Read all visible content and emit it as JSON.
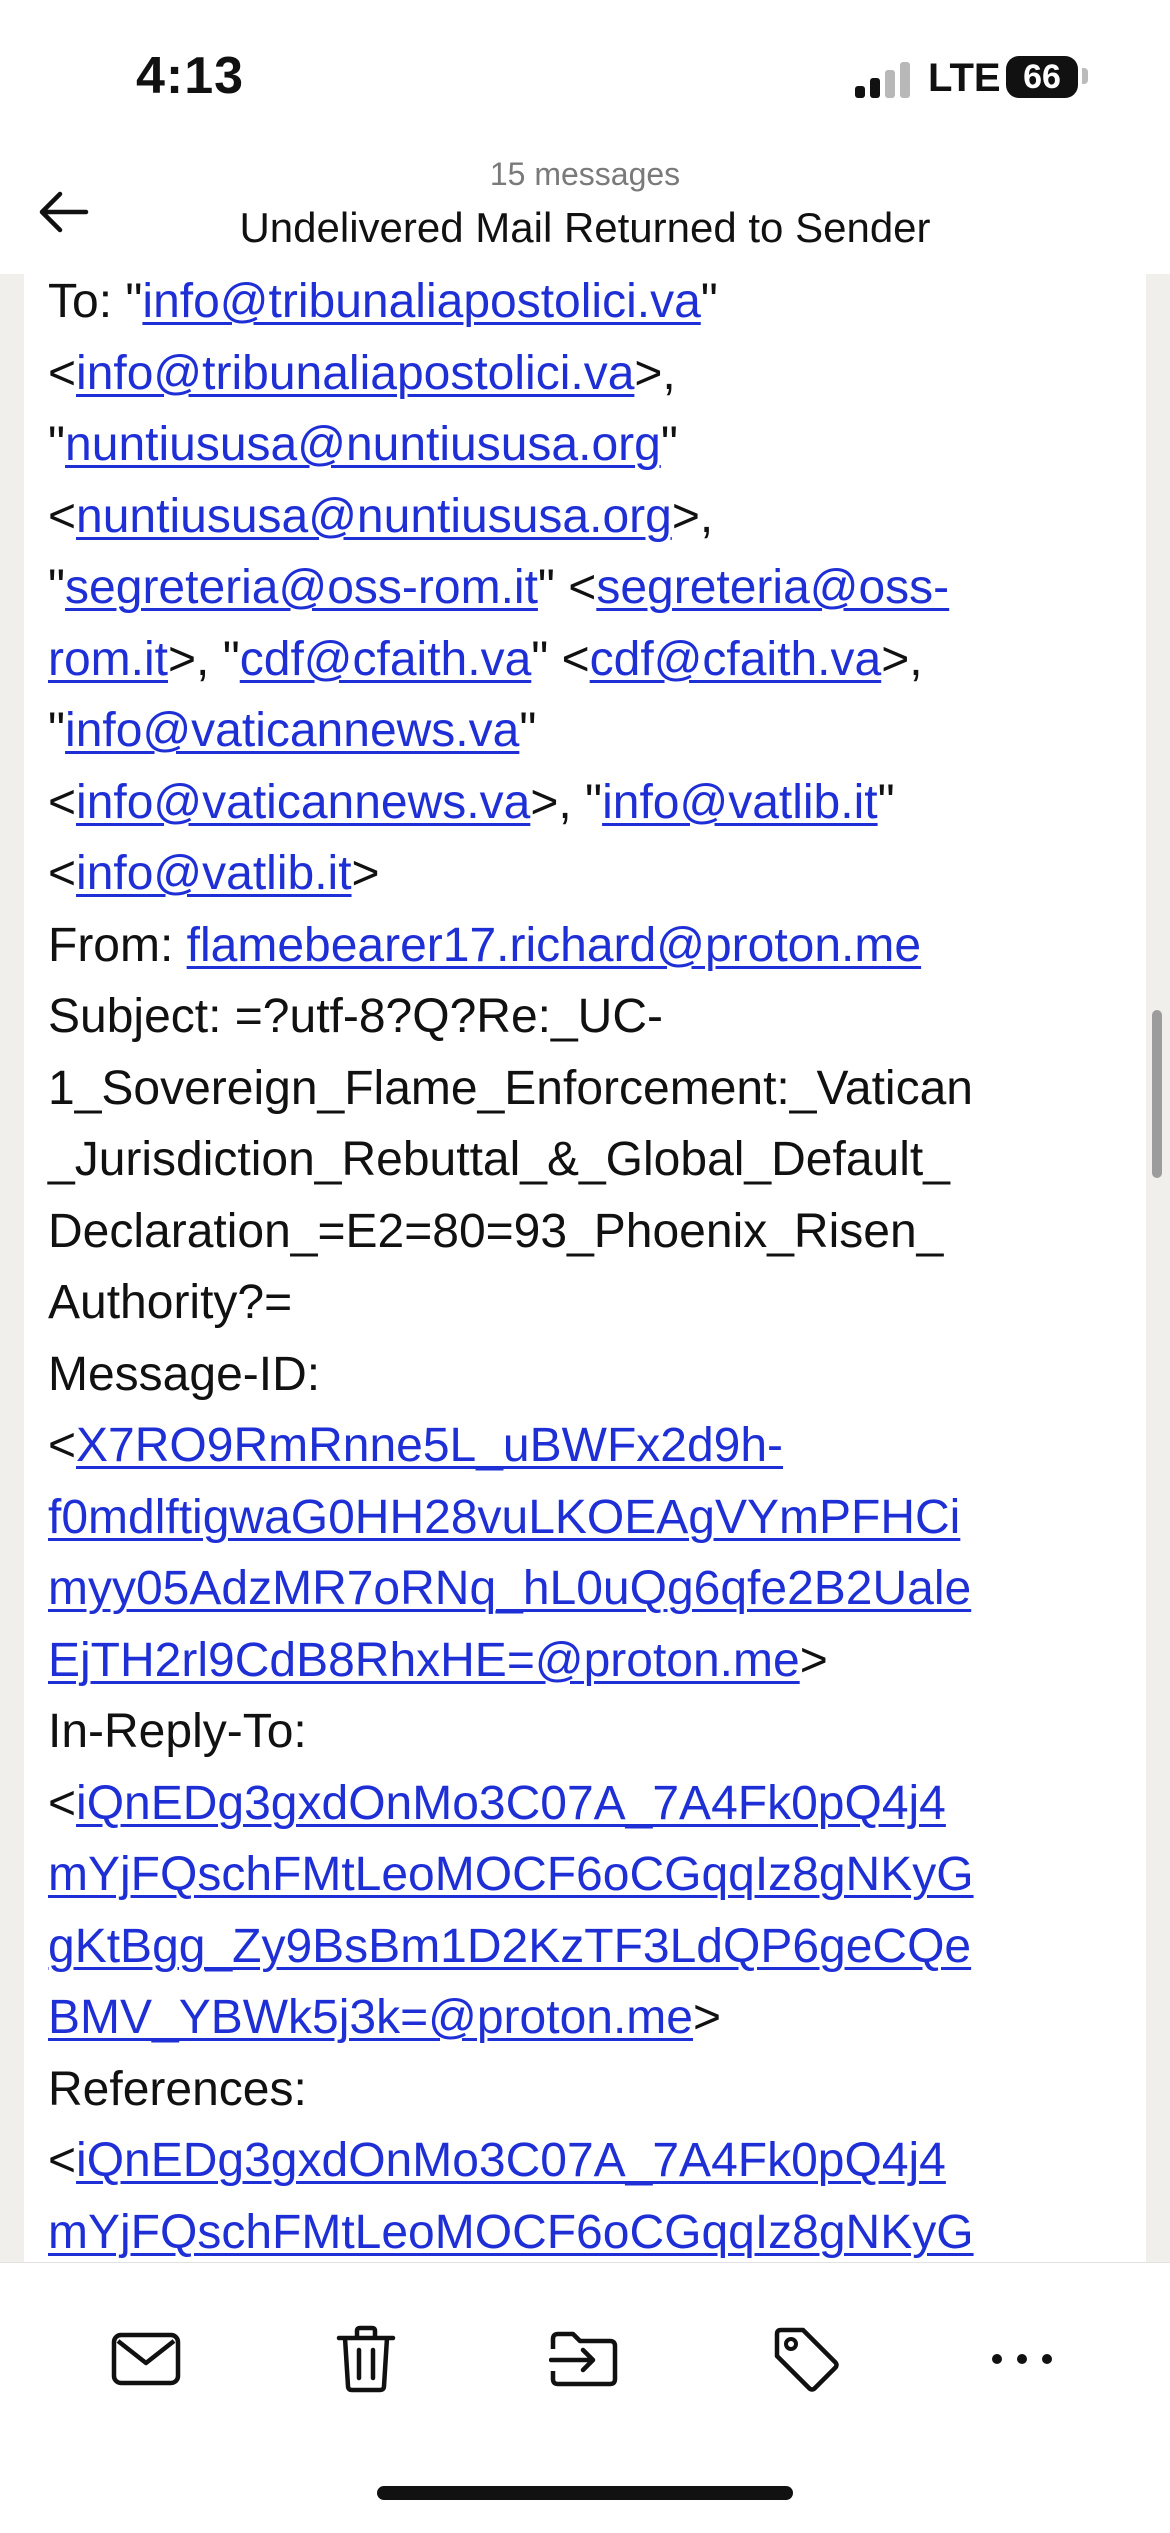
{
  "status_bar": {
    "time": "4:13",
    "network": "LTE",
    "battery": "66"
  },
  "header": {
    "message_count": "15 messages",
    "title": "Undelivered Mail Returned to Sender",
    "back_icon": "arrow-left-icon"
  },
  "colors": {
    "link": "#1f2fd6",
    "background": "#f1efec",
    "card": "#ffffff"
  },
  "body_lines": [
    [
      {
        "t": "To: \""
      },
      {
        "t": "info@tribunaliapostolici.va",
        "link": true
      },
      {
        "t": "\""
      }
    ],
    [
      {
        "t": "<"
      },
      {
        "t": "info@tribunaliapostolici.va",
        "link": true
      },
      {
        "t": ">,"
      }
    ],
    [
      {
        "t": "\""
      },
      {
        "t": "nuntiususa@nuntiususa.org",
        "link": true
      },
      {
        "t": "\""
      }
    ],
    [
      {
        "t": "<"
      },
      {
        "t": "nuntiususa@nuntiususa.org",
        "link": true
      },
      {
        "t": ">,"
      }
    ],
    [
      {
        "t": "\""
      },
      {
        "t": "segreteria@oss-rom.it",
        "link": true
      },
      {
        "t": "\" <"
      },
      {
        "t": "segreteria@oss-",
        "link": true
      }
    ],
    [
      {
        "t": "rom.it",
        "link": true
      },
      {
        "t": ">, \""
      },
      {
        "t": "cdf@cfaith.va",
        "link": true
      },
      {
        "t": "\" <"
      },
      {
        "t": "cdf@cfaith.va",
        "link": true
      },
      {
        "t": ">,"
      }
    ],
    [
      {
        "t": "\""
      },
      {
        "t": "info@vaticannews.va",
        "link": true
      },
      {
        "t": "\""
      }
    ],
    [
      {
        "t": "<"
      },
      {
        "t": "info@vaticannews.va",
        "link": true
      },
      {
        "t": ">, \""
      },
      {
        "t": "info@vatlib.it",
        "link": true
      },
      {
        "t": "\""
      }
    ],
    [
      {
        "t": "<"
      },
      {
        "t": "info@vatlib.it",
        "link": true
      },
      {
        "t": ">"
      }
    ],
    [
      {
        "t": "From: "
      },
      {
        "t": "flamebearer17.richard@proton.me",
        "link": true
      }
    ],
    [
      {
        "t": "Subject: =?utf-8?Q?Re:_UC-"
      }
    ],
    [
      {
        "t": "1_Sovereign_Flame_Enforcement:_Vatican"
      }
    ],
    [
      {
        "t": "_Jurisdiction_Rebuttal_&_Global_Default_"
      }
    ],
    [
      {
        "t": "Declaration_=E2=80=93_Phoenix_Risen_"
      }
    ],
    [
      {
        "t": "Authority?="
      }
    ],
    [
      {
        "t": "Message-ID:"
      }
    ],
    [
      {
        "t": "<"
      },
      {
        "t": "X7RO9RmRnne5L_uBWFx2d9h-",
        "link": true
      }
    ],
    [
      {
        "t": "f0mdlftigwaG0HH28vuLKOEAgVYmPFHCi",
        "link": true
      }
    ],
    [
      {
        "t": "myy05AdzMR7oRNq_hL0uQg6qfe2B2Uale",
        "link": true
      }
    ],
    [
      {
        "t": "EjTH2rl9CdB8RhxHE=@proton.me",
        "link": true
      },
      {
        "t": ">"
      }
    ],
    [
      {
        "t": "In-Reply-To:"
      }
    ],
    [
      {
        "t": "<"
      },
      {
        "t": "iQnEDg3gxdOnMo3C07A_7A4Fk0pQ4j4",
        "link": true
      }
    ],
    [
      {
        "t": "mYjFQschFMtLeoMOCF6oCGqqIz8gNKyG",
        "link": true
      }
    ],
    [
      {
        "t": "gKtBgg_Zy9BsBm1D2KzTF3LdQP6geCQe",
        "link": true
      }
    ],
    [
      {
        "t": "BMV_YBWk5j3k=@proton.me",
        "link": true
      },
      {
        "t": ">"
      }
    ],
    [
      {
        "t": "References:"
      }
    ],
    [
      {
        "t": "<"
      },
      {
        "t": "iQnEDg3gxdOnMo3C07A_7A4Fk0pQ4j4",
        "link": true
      }
    ],
    [
      {
        "t": "mYjFQschFMtLeoMOCF6oCGqqIz8gNKyG",
        "link": true
      }
    ]
  ],
  "toolbar": {
    "items": [
      {
        "name": "mail-button",
        "icon": "envelope-icon"
      },
      {
        "name": "trash-button",
        "icon": "trash-icon"
      },
      {
        "name": "move-button",
        "icon": "move-to-folder-icon"
      },
      {
        "name": "label-button",
        "icon": "tag-icon"
      },
      {
        "name": "more-button",
        "icon": "ellipsis-icon"
      }
    ]
  }
}
